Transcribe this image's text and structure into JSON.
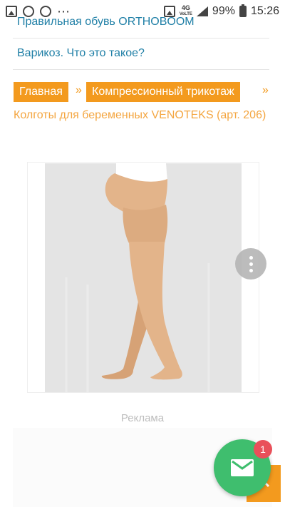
{
  "status_bar": {
    "network": "4G",
    "network_sub": "VoLTE",
    "battery": "99%",
    "time": "15:26"
  },
  "articles": [
    {
      "title": "Правильная обувь ORTHOBOOM"
    },
    {
      "title": "Варикоз. Что это такое?"
    }
  ],
  "breadcrumbs": {
    "home": "Главная",
    "category": "Компрессионный трикотаж",
    "separator": "»",
    "current": "Колготы для беременных VENOTEKS (арт. 206)"
  },
  "product": {
    "image_icon": "product-photo"
  },
  "ad": {
    "label": "Реклама"
  },
  "mail_fab": {
    "badge_count": "1",
    "icon": "mail-icon"
  },
  "colors": {
    "accent": "#f39a1e",
    "link": "#1f7fa6",
    "fab": "#3fbe6e",
    "badge": "#e9505a"
  }
}
